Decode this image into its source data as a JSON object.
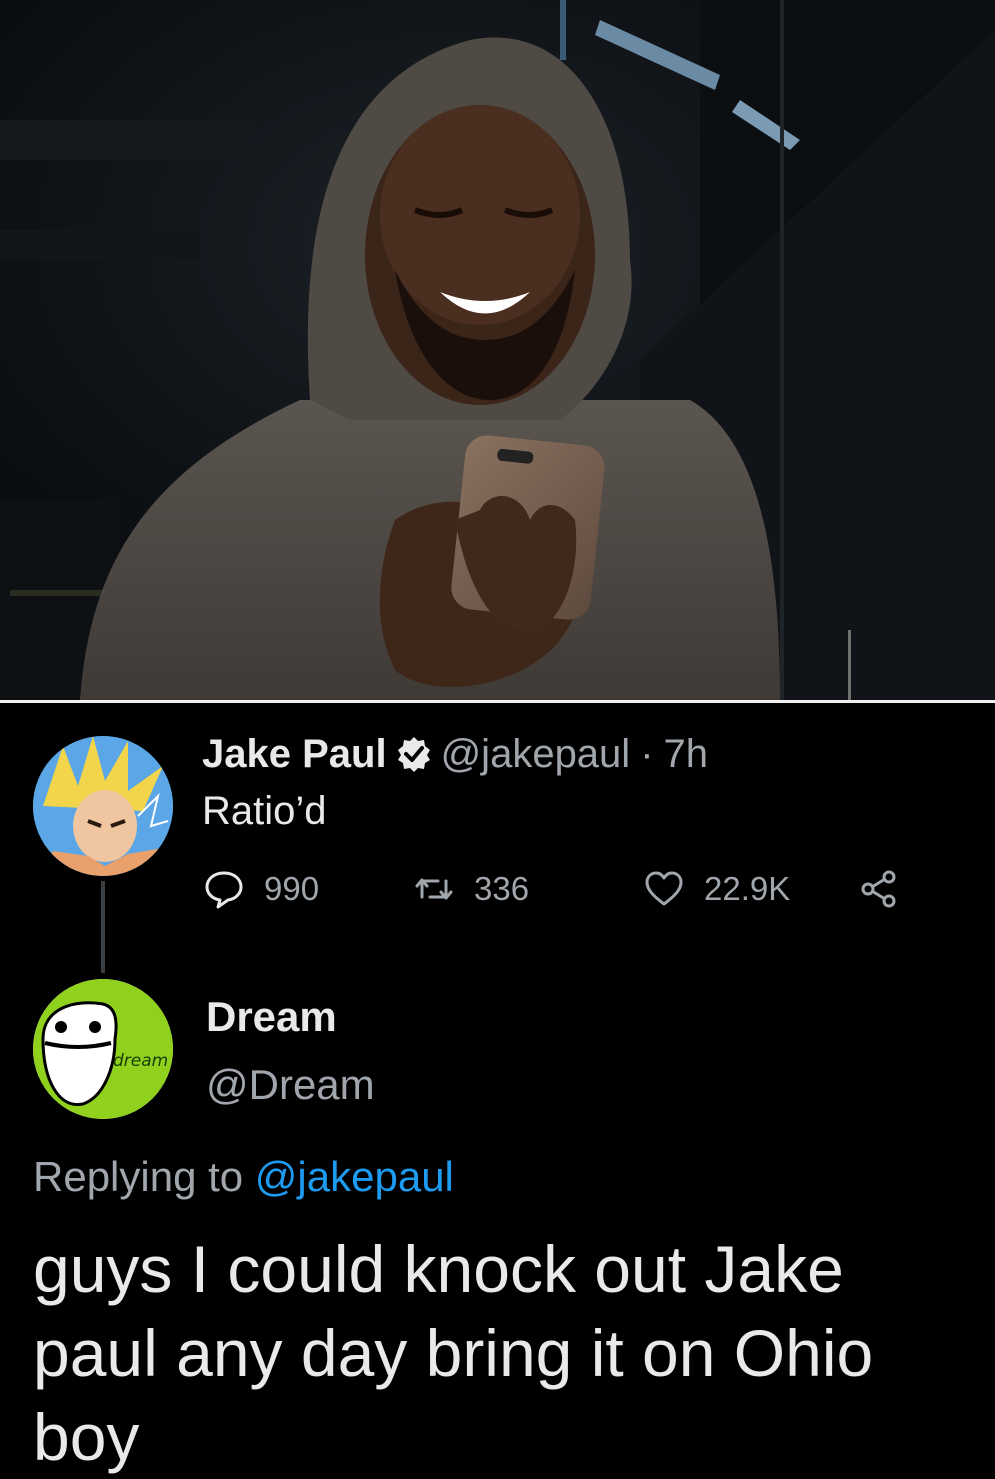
{
  "photo": {
    "subject": ""
  },
  "tweet": {
    "author_name": "Jake Paul",
    "handle": "@jakepaul",
    "separator": "·",
    "time": "7h",
    "text": "Ratio’d",
    "stats": {
      "replies": "990",
      "retweets": "336",
      "likes": "22.9K"
    }
  },
  "reply": {
    "author_name": "Dream",
    "handle": "@Dream",
    "avatar_label": "dream",
    "replying_prefix": "Replying to",
    "replying_handle": "@jakepaul",
    "text": "guys I could knock out Jake paul any day bring it on Ohio boy"
  },
  "colors": {
    "background": "#000000",
    "text_primary": "#e7e9ea",
    "text_secondary": "#a0a6ab",
    "link": "#1d9bf0",
    "dream_green": "#8fd11d"
  },
  "icons": {
    "reply": "speech-bubble-icon",
    "retweet": "retweet-arrows-icon",
    "like": "heart-icon",
    "share": "share-nodes-icon",
    "verified": "verified-badge-icon"
  }
}
